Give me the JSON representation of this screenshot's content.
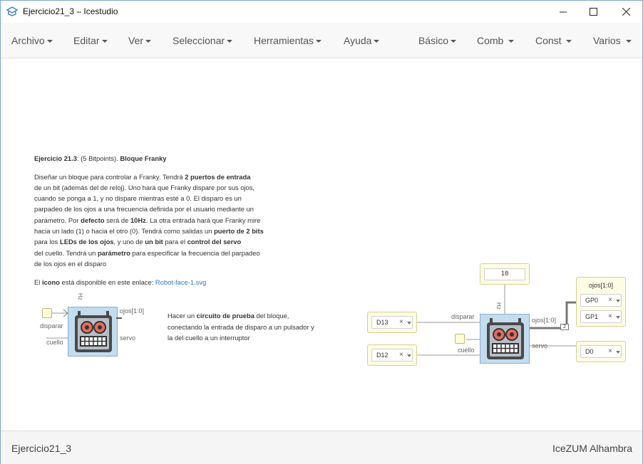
{
  "window": {
    "title": "Ejercicio21_3 – Icestudio",
    "minimize": "—",
    "maximize": "☐",
    "close": "✕"
  },
  "menu": {
    "archivo": "Archivo",
    "editar": "Editar",
    "ver": "Ver",
    "seleccionar": "Seleccionar",
    "herramientas": "Herramientas",
    "ayuda": "Ayuda",
    "basico": "Básico",
    "comb": "Comb",
    "const": "Const",
    "varios": "Varios"
  },
  "info": {
    "line1_a": "Ejercicio 21.3",
    "line1_b": ": (5 Bitpoints). ",
    "line1_c": "Bloque Franky",
    "p2_l1_a": "Diseñar un bloque para controlar a Franky. Tendrá ",
    "p2_l1_b": "2 puertos de entrada",
    "p2_l2": "de un bit (además del de reloj). Uno hará que Franky dispare por sus ojos,",
    "p2_l3": "cuando se ponga a 1, y no dispare mientras esté a 0. El disparo es un",
    "p2_l4": "parpadeo de los ojos a una frecuencia definida por el usuario mediante un",
    "p2_l5_a": "parámetro. Por ",
    "p2_l5_b": "defecto",
    "p2_l5_c": " será de ",
    "p2_l5_d": "10Hz",
    "p2_l5_e": ". La otra entrada hará que Franky mire",
    "p2_l6_a": "hacia un lado (1) o hacia el otro (0). Tendrá como salidas un ",
    "p2_l6_b": "puerto de 2 bits",
    "p2_l7_a": "para los ",
    "p2_l7_b": "LEDs de los ojos",
    "p2_l7_c": ", y uno de ",
    "p2_l7_d": "un bit",
    "p2_l7_e": " para el ",
    "p2_l7_f": "control del servo",
    "p2_l8_a": "del cuello. Tendrá un ",
    "p2_l8_b": "parámetro",
    "p2_l8_c": " para especificar la frecuencia del parpadeo",
    "p2_l9": "de los ojos en el disparo",
    "p3_a": "El ",
    "p3_b": "icono",
    "p3_c": " está disponible en este enlace: ",
    "p3_link": "Robot-face-1.svg",
    "p4_l1_a": "Hacer un ",
    "p4_l1_b": "circuito de prueba",
    "p4_l1_c": " del bloque,",
    "p4_l2": "conectando la entrada de disparo a un pulsador y",
    "p4_l3": "la del cuello a un interruptor"
  },
  "left_block": {
    "label_hz": "Hz",
    "port_disparar": "disparar",
    "port_cuello": "cuello",
    "port_ojos": "ojos[1:0]",
    "port_servo": "servo"
  },
  "circuit": {
    "const_value": "10",
    "in1_value": "D13",
    "in2_value": "D12",
    "out_ojos_title": "ojos[1:0]",
    "out_gp0": "GP0",
    "out_gp1": "GP1",
    "out_servo_value": "D0",
    "label_hz": "Hz",
    "port_disparar": "disparar",
    "port_cuello": "cuello",
    "port_ojos": "ojos[1:0]",
    "port_servo": "servo",
    "bus_width": "2",
    "clear_glyph": "×"
  },
  "footer": {
    "filename": "Ejercicio21_3",
    "board": "IceZUM Alhambra"
  }
}
